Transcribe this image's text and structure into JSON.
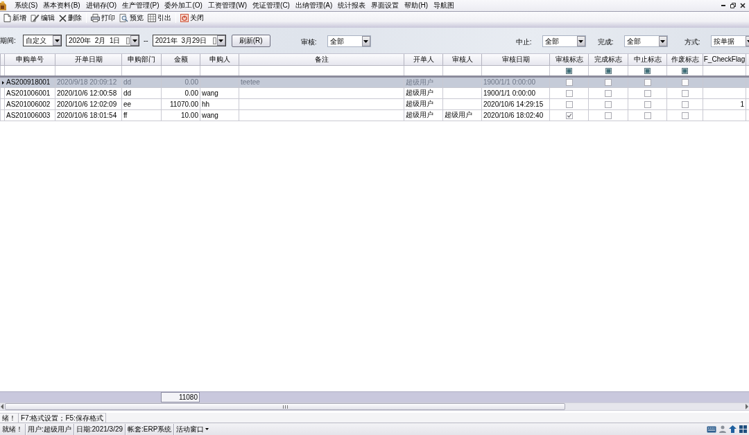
{
  "menu_bar": {
    "items": [
      "系统(S)",
      "基本资料(B)",
      "进销存(O)",
      "生产管理(P)",
      "委外加工(O)",
      "工资管理(W)",
      "凭证管理(C)",
      "出纳管理(A)",
      "统计报表",
      "界面设置",
      "帮助(H)",
      "导航图"
    ]
  },
  "toolbar": {
    "groups": [
      [
        "新增",
        "编辑",
        "删除"
      ],
      [
        "打印",
        "预览",
        "引出"
      ],
      [
        "关闭"
      ]
    ]
  },
  "filter": {
    "period": {
      "label": "期间:",
      "mode": "自定义",
      "from": "2020年  2月  1日",
      "separator": "--",
      "to": "2021年  3月29日"
    },
    "refresh_button": "刷新(R)",
    "selects": [
      {
        "label": "审核:",
        "value": "全部"
      },
      {
        "label": "中止:",
        "value": "全部"
      },
      {
        "label": "完成:",
        "value": "全部"
      },
      {
        "label": "方式:",
        "value": "按单据"
      }
    ]
  },
  "table": {
    "columns": [
      "申购单号",
      "开单日期",
      "申购部门",
      "金额",
      "申购人",
      "备注",
      "开单人",
      "审核人",
      "审核日期",
      "审核标志",
      "完成标志",
      "中止标志",
      "作废标志",
      "F_CheckFlag"
    ],
    "filter_row": {
      "flags": [
        {
          "indeterminate": true
        },
        {
          "indeterminate": true
        },
        {
          "indeterminate": true
        },
        {
          "indeterminate": true
        }
      ]
    },
    "rows": [
      {
        "selected": true,
        "number": "AS200918001",
        "opened": "2020/9/18 20:09:12",
        "department": "dd",
        "amount": "0.00",
        "note": "teetee",
        "creator": "超级用户",
        "review_date": "1900/1/1 0:00:00",
        "flags": [
          {
            "checked": false
          },
          {
            "checked": false
          },
          {
            "checked": false
          },
          {
            "checked": false
          }
        ]
      },
      {
        "selected": false,
        "number": "AS201006001",
        "opened": "2020/10/6 12:00:58",
        "department": "dd",
        "amount": "0.00",
        "requester": "wang",
        "creator": "超级用户",
        "review_date": "1900/1/1 0:00:00",
        "flags": [
          {
            "checked": false
          },
          {
            "checked": false
          },
          {
            "checked": false
          },
          {
            "checked": false
          }
        ]
      },
      {
        "selected": false,
        "number": "AS201006002",
        "opened": "2020/10/6 12:02:09",
        "department": "ee",
        "amount": "11070.00",
        "requester": "hh",
        "creator": "超级用户",
        "review_date": "2020/10/6 14:29:15",
        "flags": [
          {
            "checked": false
          },
          {
            "checked": false
          },
          {
            "checked": false
          },
          {
            "checked": false
          }
        ],
        "check_flag": "1"
      },
      {
        "selected": false,
        "number": "AS201006003",
        "opened": "2020/10/6 18:01:54",
        "department": "ff",
        "amount": "10.00",
        "requester": "wang",
        "creator": "超级用户",
        "reviewer": "超级用户",
        "review_date": "2020/10/6 18:02:40",
        "flags": [
          {
            "checked": true
          },
          {
            "checked": false
          },
          {
            "checked": false
          },
          {
            "checked": false
          }
        ]
      }
    ]
  },
  "summary": {
    "amount_total": "11080"
  },
  "status": {
    "hints": [
      "绪！",
      "F7:格式设置；F5:保存格式"
    ],
    "panels": [
      {
        "text": "就绪！",
        "dropdown": false
      },
      {
        "text": "用户:超级用户",
        "dropdown": false
      },
      {
        "text": "日期:2021/3/29",
        "dropdown": false
      },
      {
        "text": "帐套:ERP系统",
        "dropdown": false
      },
      {
        "text": "活动窗口",
        "dropdown": true
      }
    ]
  }
}
